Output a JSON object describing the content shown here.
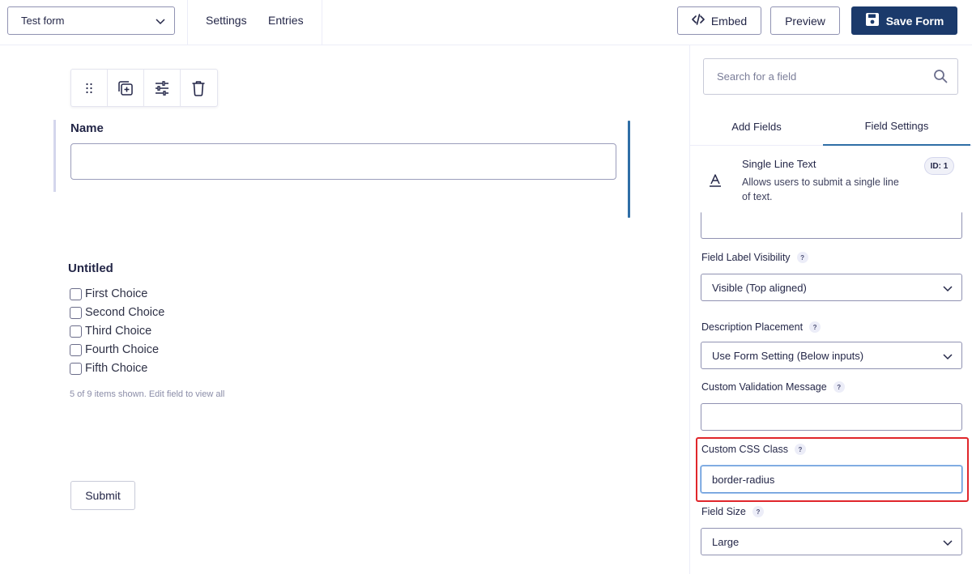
{
  "topbar": {
    "form_selector": "Test form",
    "nav": [
      "Settings",
      "Entries"
    ],
    "embed_label": "Embed",
    "preview_label": "Preview",
    "save_label": "Save Form"
  },
  "canvas": {
    "name_field": {
      "label": "Name"
    },
    "checkbox_field": {
      "label": "Untitled",
      "choices": [
        "First Choice",
        "Second Choice",
        "Third Choice",
        "Fourth Choice",
        "Fifth Choice"
      ],
      "note": "5 of 9 items shown. Edit field to view all"
    },
    "submit_label": "Submit"
  },
  "sidebar": {
    "search_placeholder": "Search for a field",
    "tabs": [
      "Add Fields",
      "Field Settings"
    ],
    "active_tab": "Field Settings",
    "field": {
      "title": "Single Line Text",
      "description": "Allows users to submit a single line of text.",
      "id_badge": "ID: 1"
    },
    "settings": {
      "label_visibility": {
        "label": "Field Label Visibility",
        "value": "Visible (Top aligned)"
      },
      "description_placement": {
        "label": "Description Placement",
        "value": "Use Form Setting (Below inputs)"
      },
      "validation_message": {
        "label": "Custom Validation Message",
        "value": ""
      },
      "css_class": {
        "label": "Custom CSS Class",
        "value": "border-radius"
      },
      "field_size": {
        "label": "Field Size",
        "value": "Large"
      }
    },
    "help_glyph": "?"
  },
  "colors": {
    "primary": "#1b3a6b",
    "accent": "#2f6ea6",
    "highlight": "#e0262b"
  }
}
